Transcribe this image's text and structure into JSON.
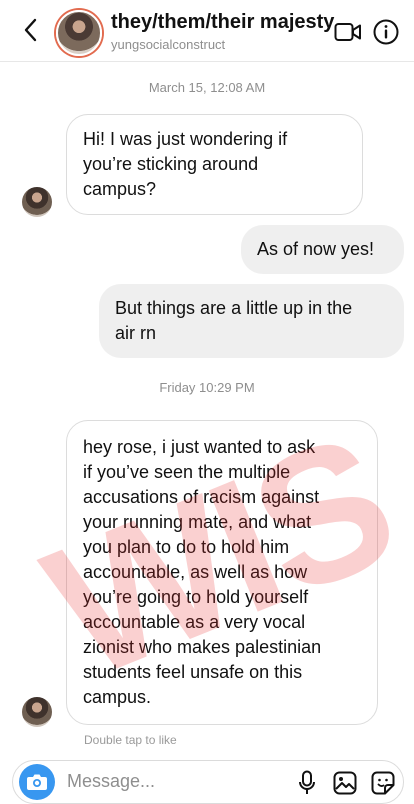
{
  "header": {
    "title": "they/them/their majesty",
    "subtitle": "yungsocialconstruct",
    "icons": {
      "back": "chevron-left-icon",
      "video": "video-camera-icon",
      "info": "info-icon"
    }
  },
  "thread": {
    "timestamp_1": "March 15, 12:08 AM",
    "timestamp_2": "Friday 10:29 PM",
    "messages": [
      {
        "direction": "incoming",
        "lines": [
          "Hi! I was just wondering if",
          "you’re sticking around",
          "campus?"
        ]
      },
      {
        "direction": "outgoing",
        "lines": [
          "As of now yes!"
        ]
      },
      {
        "direction": "outgoing",
        "lines": [
          "But things are a little up in the",
          "air rn"
        ]
      },
      {
        "direction": "incoming",
        "lines": [
          "hey rose, i just wanted to ask",
          "if you’ve seen the multiple",
          "accusations of racism against",
          "your running mate, and what",
          "you plan to do to hold him",
          "accountable, as well as how",
          "you’re going to hold yourself",
          "accountable as a very vocal",
          "zionist who makes palestinian",
          "students feel unsafe on this",
          "campus."
        ]
      }
    ],
    "double_tap_hint": "Double tap to like"
  },
  "composer": {
    "placeholder": "Message...",
    "icons": {
      "camera": "camera-icon",
      "mic": "microphone-icon",
      "gallery": "image-icon",
      "sticker": "sticker-icon"
    },
    "accent": "#3897f0"
  },
  "watermark": "WIS",
  "colors": {
    "outgoing_bubble": "#efefef",
    "incoming_border": "#dcdcdc",
    "watermark": "#e82828"
  }
}
